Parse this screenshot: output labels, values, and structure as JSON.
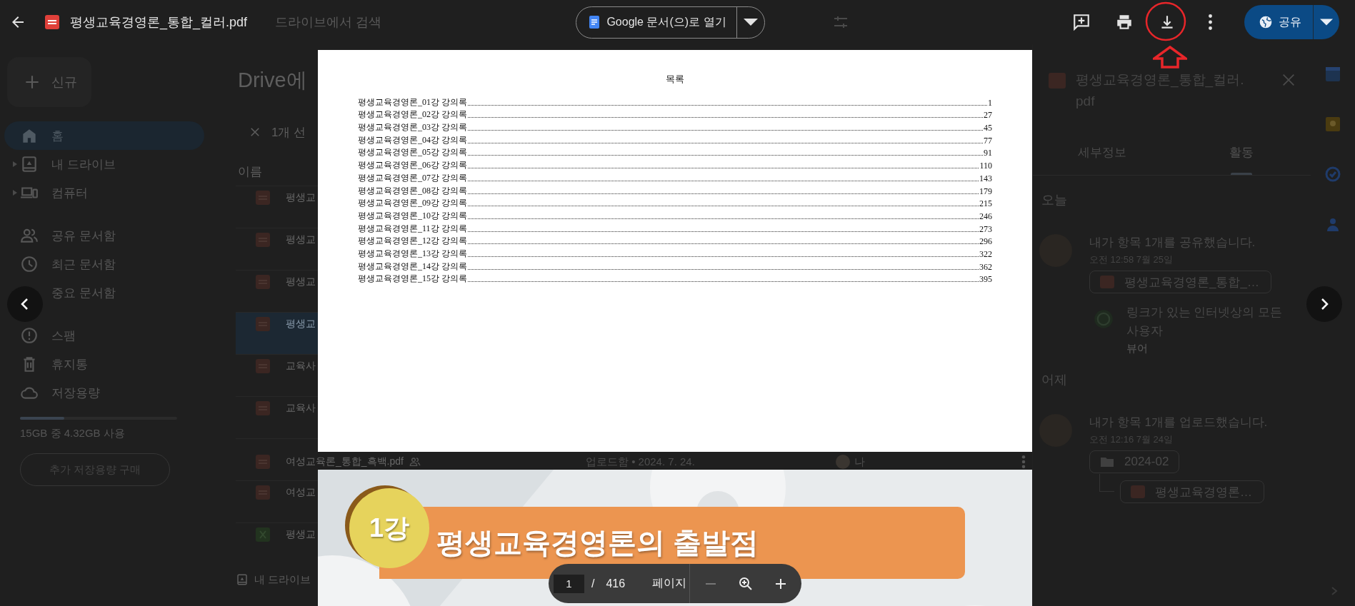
{
  "viewer": {
    "title": "평생교육경영론_통합_컬러.pdf",
    "open_with": "Google 문서(으)로 열기",
    "share": "공유",
    "page_input": "1",
    "page_separator": "/",
    "page_total": "416",
    "page_label": "페이지"
  },
  "background_search": "드라이브에서 검색",
  "sidebar": {
    "new_button": "신규",
    "sections": [
      [
        {
          "label": "홈",
          "selected": true
        },
        {
          "label": "내 드라이브",
          "selected": false,
          "expandable": true
        },
        {
          "label": "컴퓨터",
          "selected": false,
          "expandable": true
        }
      ],
      [
        {
          "label": "공유 문서함",
          "selected": false
        },
        {
          "label": "최근 문서함",
          "selected": false
        },
        {
          "label": "중요 문서함",
          "selected": false
        }
      ],
      [
        {
          "label": "스팸",
          "selected": false
        },
        {
          "label": "휴지통",
          "selected": false
        },
        {
          "label": "저장용량",
          "selected": false
        }
      ]
    ],
    "storage": {
      "level": 0.28,
      "text": "15GB 중 4.32GB 사용",
      "buy_button": "추가 저장용량 구매"
    }
  },
  "main": {
    "title": "Drive에",
    "selection": "1개 선",
    "column_header": "이름",
    "rows": [
      {
        "name": "평생교",
        "kind": "pdf",
        "selected": false
      },
      {
        "name": "평생교",
        "kind": "pdf",
        "selected": false
      },
      {
        "name": "평생교",
        "kind": "pdf",
        "selected": false
      },
      {
        "name": "평생교",
        "kind": "pdf",
        "selected": true
      },
      {
        "name": "교육사",
        "kind": "pdf",
        "selected": false
      },
      {
        "name": "교육사",
        "kind": "pdf",
        "selected": false
      },
      {
        "name": "여성교육론_통합_흑백.pdf",
        "kind": "pdf",
        "selected": false,
        "shared": true,
        "detail": "업로드함 • 2024. 7. 24.",
        "owner": "나"
      },
      {
        "name": "여성교",
        "kind": "pdf",
        "selected": false
      },
      {
        "name": "평생교",
        "kind": "sheet",
        "selected": false
      }
    ],
    "footer": "내 드라이브"
  },
  "details": {
    "title": "평생교육경영론_통합_컬러.pdf",
    "tabs": [
      {
        "label": "세부정보",
        "selected": false
      },
      {
        "label": "활동",
        "selected": true
      }
    ],
    "groups": [
      {
        "day": "오늘",
        "events": [
          {
            "text": "내가 항목 1개를 공유했습니다.",
            "time": "오전 12:58 7월 25일",
            "chips": [
              {
                "kind": "pdf",
                "label": "평생교육경영론_통합_…",
                "nested": false
              }
            ],
            "access": {
              "who": "링크가 있는 인터넷상의 모든 사용자",
              "role": "뷰어"
            }
          }
        ]
      },
      {
        "day": "어제",
        "events": [
          {
            "text": "내가 항목 1개를 업로드했습니다.",
            "time": "오전 12:16 7월 24일",
            "chips": [
              {
                "kind": "folder",
                "label": "2024-02",
                "nested": false
              },
              {
                "kind": "pdf",
                "label": "평생교육경영론…",
                "nested": true
              }
            ]
          }
        ]
      }
    ]
  },
  "document": {
    "pages": [
      {
        "kind": "toc",
        "heading": "목록",
        "entries": [
          {
            "title": "평생교육경영론_01강 강의록",
            "page": "1"
          },
          {
            "title": "평생교육경영론_02강 강의록",
            "page": "27"
          },
          {
            "title": "평생교육경영론_03강 강의록",
            "page": "45"
          },
          {
            "title": "평생교육경영론_04강 강의록",
            "page": "77"
          },
          {
            "title": "평생교육경영론_05강 강의록",
            "page": "91"
          },
          {
            "title": "평생교육경영론_06강 강의록",
            "page": "110"
          },
          {
            "title": "평생교육경영론_07강 강의록",
            "page": "143"
          },
          {
            "title": "평생교육경영론_08강 강의록",
            "page": "179"
          },
          {
            "title": "평생교육경영론_09강 강의록",
            "page": "215"
          },
          {
            "title": "평생교육경영론_10강 강의록",
            "page": "246"
          },
          {
            "title": "평생교육경영론_11강 강의록",
            "page": "273"
          },
          {
            "title": "평생교육경영론_12강 강의록",
            "page": "296"
          },
          {
            "title": "평생교육경영론_13강 강의록",
            "page": "322"
          },
          {
            "title": "평생교육경영론_14강 강의록",
            "page": "362"
          },
          {
            "title": "평생교육경영론_15강 강의록",
            "page": "395"
          }
        ]
      },
      {
        "kind": "slide",
        "badge": "1강",
        "title": "평생교육경영론의 출발점"
      }
    ]
  }
}
